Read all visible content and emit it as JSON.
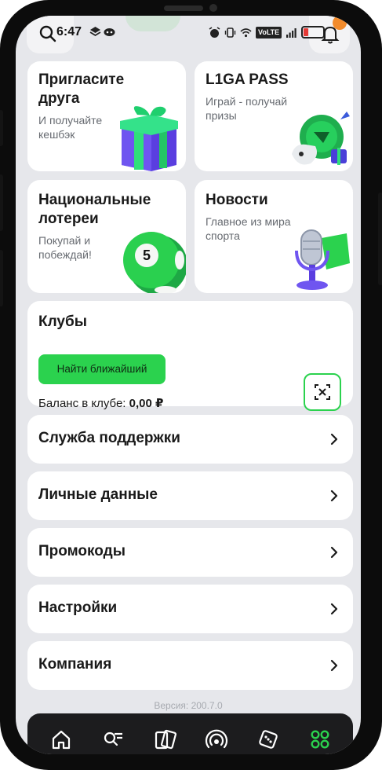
{
  "status_bar": {
    "time": "6:47",
    "network_badge": "VoLTE",
    "battery_color": "#e53935",
    "icons_left": [
      "search-icon",
      "stack-icon",
      "game-icon"
    ],
    "icons_right": [
      "alarm-icon",
      "vibrate-icon",
      "wifi-icon",
      "volte-icon",
      "signal-icon",
      "battery-icon"
    ]
  },
  "notification": {
    "icon": "bell-icon",
    "badge_color": "#f28b2c"
  },
  "cards": {
    "invite": {
      "title": "Пригласите друга",
      "subtitle": "И получайте кешбэк",
      "art": "gift-box"
    },
    "pass": {
      "title": "L1GA PASS",
      "subtitle": "Играй - получай призы",
      "art": "gamepad-prize"
    },
    "lottery": {
      "title": "Национальные лотереи",
      "subtitle": "Покупай и побеждай!",
      "art": "lottery-ball",
      "ball_number": "5"
    },
    "news": {
      "title": "Новости",
      "subtitle": "Главное из мира спорта",
      "art": "microphone"
    }
  },
  "clubs": {
    "title": "Клубы",
    "find_button": "Найти ближайший",
    "balance_label": "Баланс в клубе:",
    "balance_value": "0,00 ₽",
    "scan_icon": "qr-scan-icon"
  },
  "menu": [
    {
      "label": "Служба поддержки"
    },
    {
      "label": "Личные данные"
    },
    {
      "label": "Промокоды"
    },
    {
      "label": "Настройки"
    },
    {
      "label": "Компания"
    }
  ],
  "version_text": "Версия:  200.7.0",
  "tabbar": {
    "items": [
      "home-icon",
      "search-list-icon",
      "cards-icon",
      "live-icon",
      "casino-icon",
      "menu-grid-icon"
    ],
    "active": "menu-grid-icon",
    "active_color": "#2bd24e"
  },
  "colors": {
    "accent": "#2bd24e",
    "background": "#e6e7eb",
    "card": "#ffffff",
    "tabbar": "#1c1c1e"
  }
}
